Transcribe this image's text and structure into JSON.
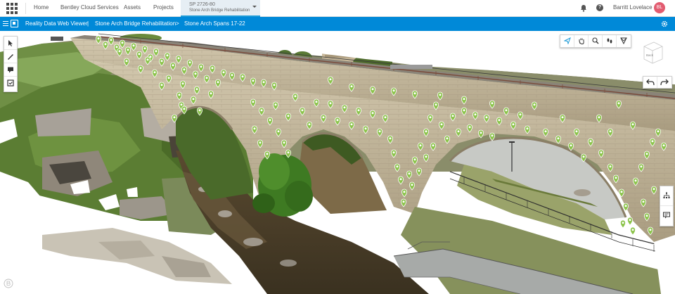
{
  "header": {
    "nav": [
      "Home",
      "Bentley Cloud Services",
      "Assets",
      "Projects"
    ],
    "project": {
      "code": "SP 2726-80",
      "name": "Stone Arch Bridge Rehabilitation"
    },
    "user": {
      "name": "Barritt Lovelace",
      "initials": "BL"
    },
    "icons": [
      "apps-grid-icon",
      "bell-icon",
      "help-icon"
    ]
  },
  "appbar": {
    "app_name": "Reality Data Web Viewer",
    "breadcrumb": [
      "Stone Arch Bridge Rehabilitation",
      "Stone Arch Spans 17-22"
    ],
    "separator": ">",
    "divider": "|"
  },
  "viewer": {
    "navcube_label": "Back",
    "left_tools": [
      "select-icon",
      "measure-icon",
      "annotation-icon",
      "inspection-icon"
    ],
    "top_tools": [
      "select-icon",
      "pan-icon",
      "zoom-icon",
      "walk-icon",
      "fit-view-icon"
    ],
    "right_tools": [
      "tree-icon",
      "comment-icon"
    ]
  },
  "colors": {
    "brand_blue": "#0089d8",
    "marker_green": "#8bc34a",
    "avatar_pink": "#e25c70",
    "stone": "#c2b59b",
    "sky": "#ffffff"
  }
}
